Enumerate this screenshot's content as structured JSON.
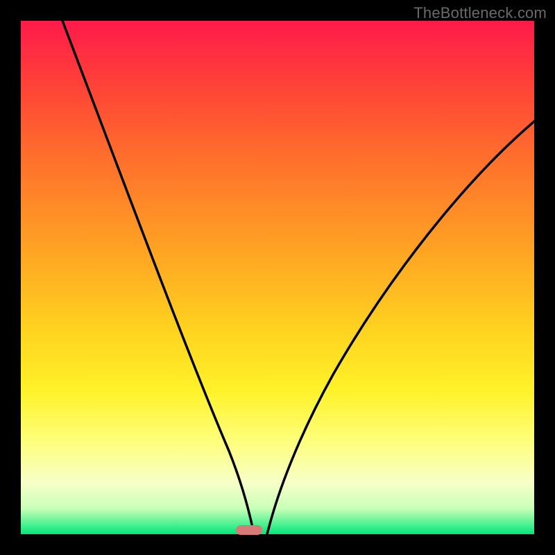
{
  "watermark_text": "TheBottleneck.com",
  "marker": {
    "x_fraction": 0.445
  },
  "chart_data": {
    "type": "line",
    "title": "",
    "xlabel": "",
    "ylabel": "",
    "xlim": [
      0,
      1
    ],
    "ylim": [
      0,
      1
    ],
    "series": [
      {
        "name": "left-curve",
        "x": [
          0.0,
          0.05,
          0.1,
          0.15,
          0.2,
          0.25,
          0.3,
          0.34,
          0.37,
          0.4,
          0.42,
          0.435,
          0.445
        ],
        "y": [
          1.0,
          0.89,
          0.78,
          0.67,
          0.56,
          0.46,
          0.35,
          0.25,
          0.17,
          0.1,
          0.05,
          0.02,
          0.0
        ]
      },
      {
        "name": "right-curve",
        "x": [
          0.47,
          0.5,
          0.54,
          0.58,
          0.63,
          0.68,
          0.74,
          0.8,
          0.87,
          0.94,
          1.0
        ],
        "y": [
          0.0,
          0.07,
          0.16,
          0.25,
          0.35,
          0.44,
          0.53,
          0.61,
          0.69,
          0.76,
          0.81
        ]
      }
    ],
    "gradient_bands": [
      {
        "position": 0.0,
        "color": "#ff1a4b"
      },
      {
        "position": 0.5,
        "color": "#ffc423"
      },
      {
        "position": 0.85,
        "color": "#fdff7d"
      },
      {
        "position": 1.0,
        "color": "#00e87a"
      }
    ]
  }
}
